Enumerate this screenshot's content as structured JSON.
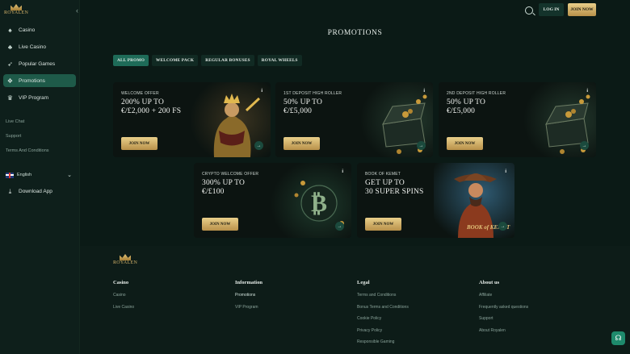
{
  "brand": {
    "logo_text": "ROYALEN"
  },
  "sidebar": {
    "items": [
      {
        "label": "Casino",
        "icon": "casino-icon"
      },
      {
        "label": "Live Casino",
        "icon": "live-casino-icon"
      },
      {
        "label": "Popular Games",
        "icon": "rocket-icon"
      },
      {
        "label": "Promotions",
        "icon": "gift-icon",
        "active": true
      },
      {
        "label": "VIP Program",
        "icon": "crown-icon"
      }
    ],
    "small_links": [
      "Live Chat",
      "Support",
      "Terms And Conditions"
    ],
    "language": "English",
    "download": "Download App"
  },
  "header": {
    "login": "LOG IN",
    "join": "JOIN NOW"
  },
  "page": {
    "title": "PROMOTIONS"
  },
  "tabs": [
    "ALL PROMO",
    "WELCOME PACK",
    "REGULAR BONUSES",
    "ROYAL WHEELS"
  ],
  "promos": [
    {
      "label": "WELCOME OFFER",
      "line1": "200% UP TO",
      "line2": "€/£2,000 + 200 FS",
      "button": "JOIN NOW"
    },
    {
      "label": "1ST DEPOSIT HIGH ROLLER",
      "line1": "50% UP TO",
      "line2": "€/£5,000",
      "button": "JOIN NOW"
    },
    {
      "label": "2ND DEPOSIT HIGH ROLLER",
      "line1": "50% UP TO",
      "line2": "€/£5,000",
      "button": "JOIN NOW"
    },
    {
      "label": "CRYPTO WELCOME OFFER",
      "line1": "300% UP TO",
      "line2": "€/£100",
      "button": "JOIN NOW"
    },
    {
      "label": "BOOK OF KEMET",
      "line1": "GET UP TO",
      "line2": "30 SUPER SPINS",
      "button": "JOIN NOW",
      "art_text": "BOOK of KEMET"
    }
  ],
  "footer": {
    "columns": [
      {
        "heading": "Casino",
        "links": [
          "Casino",
          "Live Casino"
        ]
      },
      {
        "heading": "Information",
        "links": [
          "Promotions",
          "VIP Program"
        ]
      },
      {
        "heading": "Legal",
        "links": [
          "Terms and Conditions",
          "Bonus Terms and Conditions",
          "Cookie Policy",
          "Privacy Policy",
          "Responsible Gaming"
        ]
      },
      {
        "heading": "About us",
        "links": [
          "Affiliate",
          "Frequently asked questions",
          "Support",
          "About Royalen"
        ]
      }
    ]
  },
  "colors": {
    "accent": "#1e5a49",
    "gold": "#d4b36a",
    "background": "#0b1a16"
  }
}
